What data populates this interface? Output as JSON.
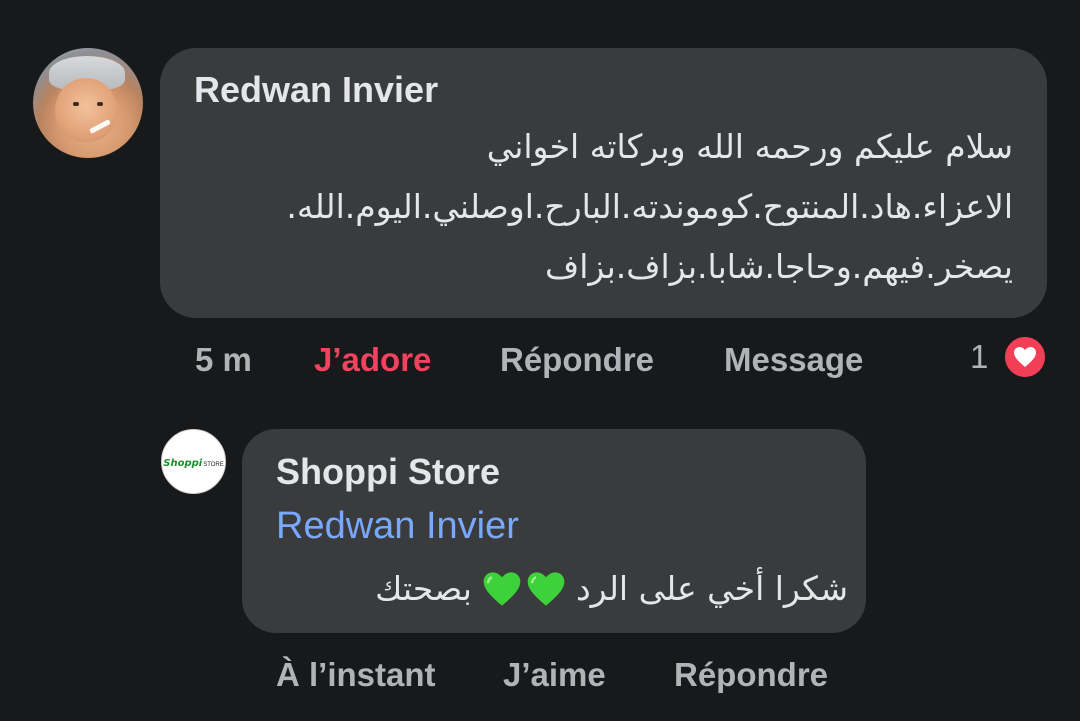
{
  "comment": {
    "author": "Redwan Invier",
    "lines": [
      "سلام عليكم ورحمه الله وبركاته اخواني",
      "الاعزاء.هاد.المنتوح.كوموندته.البارح.اوصلني.اليوم.الله.",
      "يصخر.فيهم.وحاجا.شابا.بزاف.بزاف"
    ],
    "time": "5 m",
    "like_label": "J’adore",
    "reply_label": "Répondre",
    "message_label": "Message",
    "reaction_count": "1",
    "reaction_icon": "heart-red-icon"
  },
  "reply": {
    "author": "Shoppi Store",
    "logo_text": "Shoppi",
    "logo_sub": "STORE",
    "mention": "Redwan Invier",
    "text_start": "شكرا أخي على الرد",
    "text_end": "بصحتك",
    "emoji_icon": "green-heart-icon",
    "time": "À l’instant",
    "like_label": "J’aime",
    "reply_label": "Répondre"
  },
  "colors": {
    "background": "#18191a",
    "bubble": "#3a3b3c",
    "mention": "#79a9ff",
    "liked": "#f3425f",
    "muted": "#b0b3b8"
  }
}
